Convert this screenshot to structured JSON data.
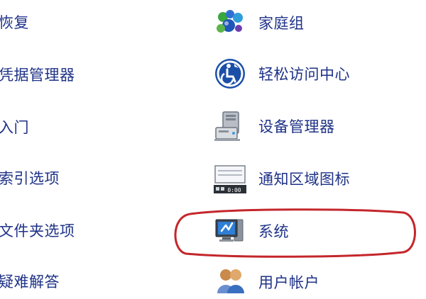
{
  "left_items": [
    {
      "label": "恢复"
    },
    {
      "label": "凭据管理器"
    },
    {
      "label": "入门"
    },
    {
      "label": "索引选项"
    },
    {
      "label": "文件夹选项"
    },
    {
      "label": "疑难解答"
    }
  ],
  "right_items": [
    {
      "label": "家庭组",
      "icon": "homegroup-icon"
    },
    {
      "label": "轻松访问中心",
      "icon": "ease-of-access-icon"
    },
    {
      "label": "设备管理器",
      "icon": "device-manager-icon"
    },
    {
      "label": "通知区域图标",
      "icon": "notification-area-icon"
    },
    {
      "label": "系统",
      "icon": "system-icon"
    },
    {
      "label": "用户帐户",
      "icon": "user-accounts-icon"
    }
  ],
  "notification_icon_clock": "0:00",
  "colors": {
    "link_text": "#1e3287",
    "highlight_circle": "#c4262b",
    "background": "#ffffff"
  }
}
